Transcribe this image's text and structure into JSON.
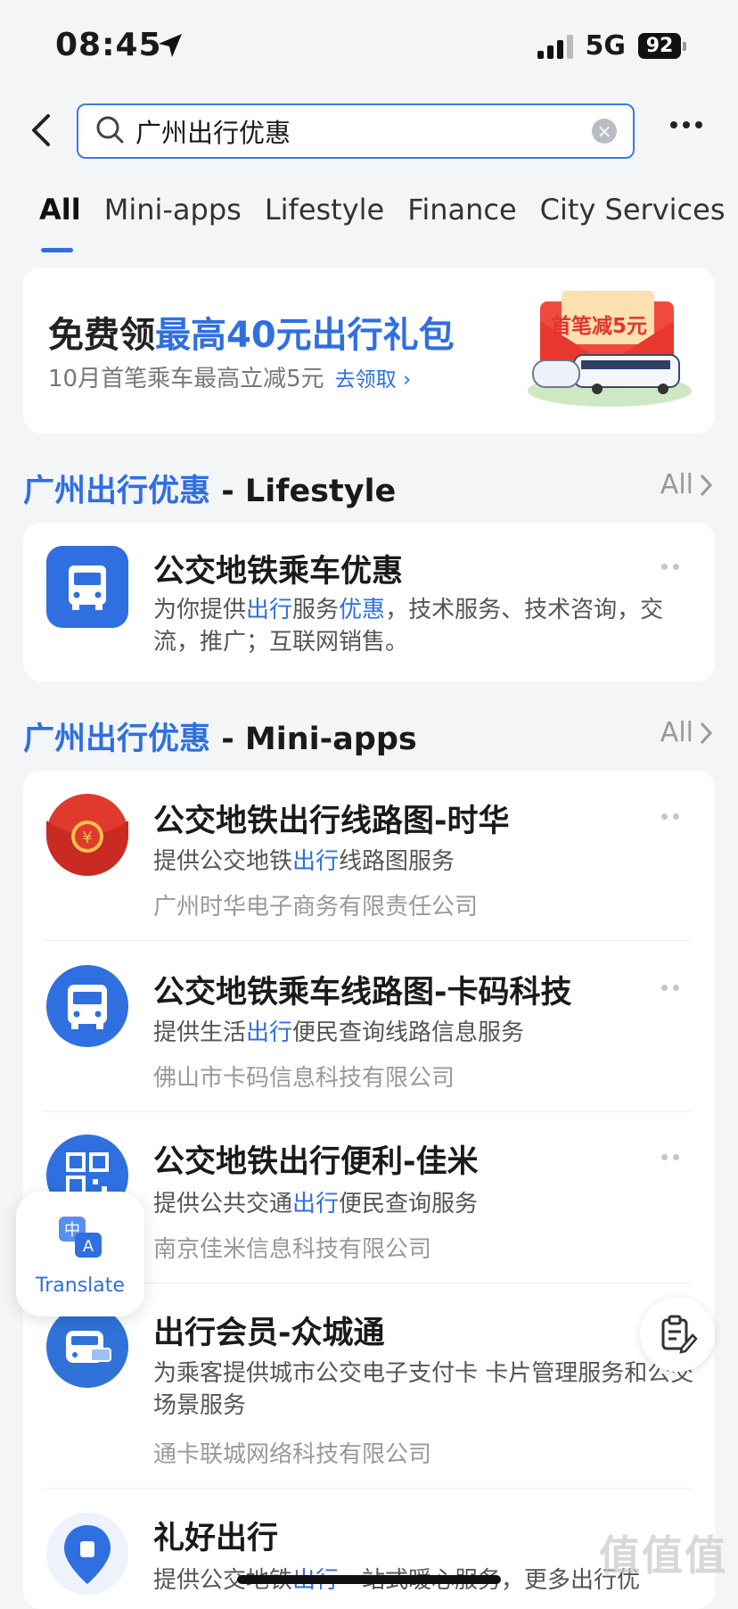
{
  "status": {
    "time": "08:45",
    "network": "5G",
    "battery": "92"
  },
  "search": {
    "query": "广州出行优惠"
  },
  "tabs": [
    "All",
    "Mini-apps",
    "Lifestyle",
    "Finance",
    "City Services"
  ],
  "banner": {
    "title_prefix": "免费领",
    "title_highlight": "最高40元出行礼包",
    "subtitle": "10月首笔乘车最高立减5元",
    "link": "去领取",
    "image_text": "首笔减5元"
  },
  "lifestyle": {
    "query_part": "广州出行优惠",
    "suffix": " - Lifestyle",
    "all": "All",
    "item": {
      "title": "公交地铁乘车优惠",
      "desc_1": "为你提供",
      "desc_hl1": "出行",
      "desc_2": "服务",
      "desc_hl2": "优惠",
      "desc_3": "，技术服务、技术咨询，交流，推广；互联网销售。"
    }
  },
  "miniapps": {
    "query_part": "广州出行优惠",
    "suffix": " - Mini-apps",
    "all": "All",
    "items": [
      {
        "title": "公交地铁出行线路图-时华",
        "desc_a": "提供公交地铁",
        "desc_hl": "出行",
        "desc_b": "线路图服务",
        "corp": "广州时华电子商务有限责任公司"
      },
      {
        "title": "公交地铁乘车线路图-卡码科技",
        "desc_a": "提供生活",
        "desc_hl": "出行",
        "desc_b": "便民查询线路信息服务",
        "corp": "佛山市卡码信息科技有限公司"
      },
      {
        "title": "公交地铁出行便利-佳米",
        "desc_a": "提供公共交通",
        "desc_hl": "出行",
        "desc_b": "便民查询服务",
        "corp": "南京佳米信息科技有限公司"
      },
      {
        "title": "出行会员-众城通",
        "desc_a": "为乘客提供城市公交电子支付卡 卡片管理服务和公交场景服务",
        "desc_hl": "",
        "desc_b": "",
        "corp": "通卡联城网络科技有限公司"
      },
      {
        "title": "礼好出行",
        "desc_a": "提供公交地铁",
        "desc_hl": "出行",
        "desc_b": "一站式暖心服务，更多出行优",
        "corp": ""
      }
    ]
  },
  "translate": {
    "label": "Translate"
  },
  "watermark": "值值值"
}
